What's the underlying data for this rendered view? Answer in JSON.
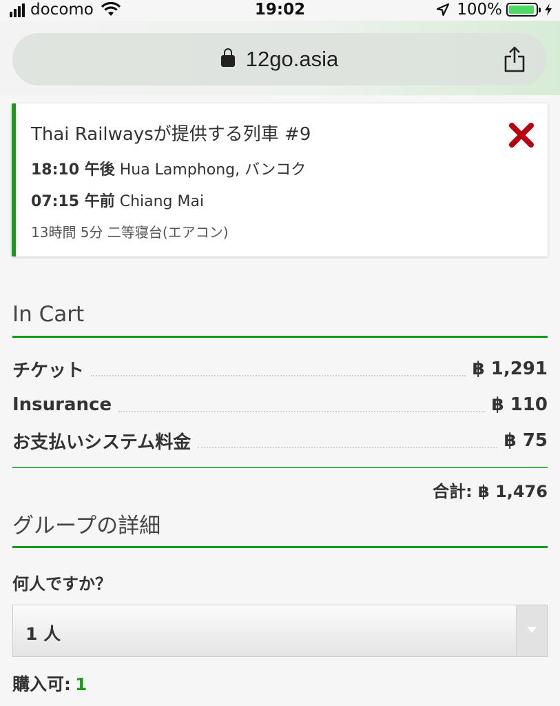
{
  "status_bar": {
    "carrier": "docomo",
    "time": "19:02",
    "battery": "100%",
    "signal_icon": "signal-bars-icon",
    "wifi_icon": "wifi-icon",
    "location_icon": "location-arrow-icon",
    "battery_icon": "battery-icon",
    "charging_icon": "bolt-icon"
  },
  "browser": {
    "url": "12go.asia",
    "lock_icon": "lock-icon",
    "share_icon": "share-icon"
  },
  "train": {
    "title": "Thai Railwaysが提供する列車 #9",
    "depart_time": "18:10 午後",
    "depart_place": "Hua Lamphong, バンコク",
    "arrive_time": "07:15 午前",
    "arrive_place": "Chiang Mai",
    "meta": "13時間 5分 二等寝台(エアコン)",
    "close_icon": "close-x-icon",
    "accent_color": "#1a9c1a",
    "close_color": "#b8000f"
  },
  "cart": {
    "title": "In Cart",
    "items": [
      {
        "label": "チケット",
        "price": "฿ 1,291"
      },
      {
        "label": "Insurance",
        "price": "฿ 110"
      },
      {
        "label": "お支払いシステム料金",
        "price": "฿ 75"
      }
    ],
    "total": "合計: ฿ 1,476"
  },
  "group": {
    "title": "グループの詳細",
    "question": "何人ですか？",
    "selected": "1 人",
    "available_label": "購入可:",
    "available_value": "1"
  }
}
